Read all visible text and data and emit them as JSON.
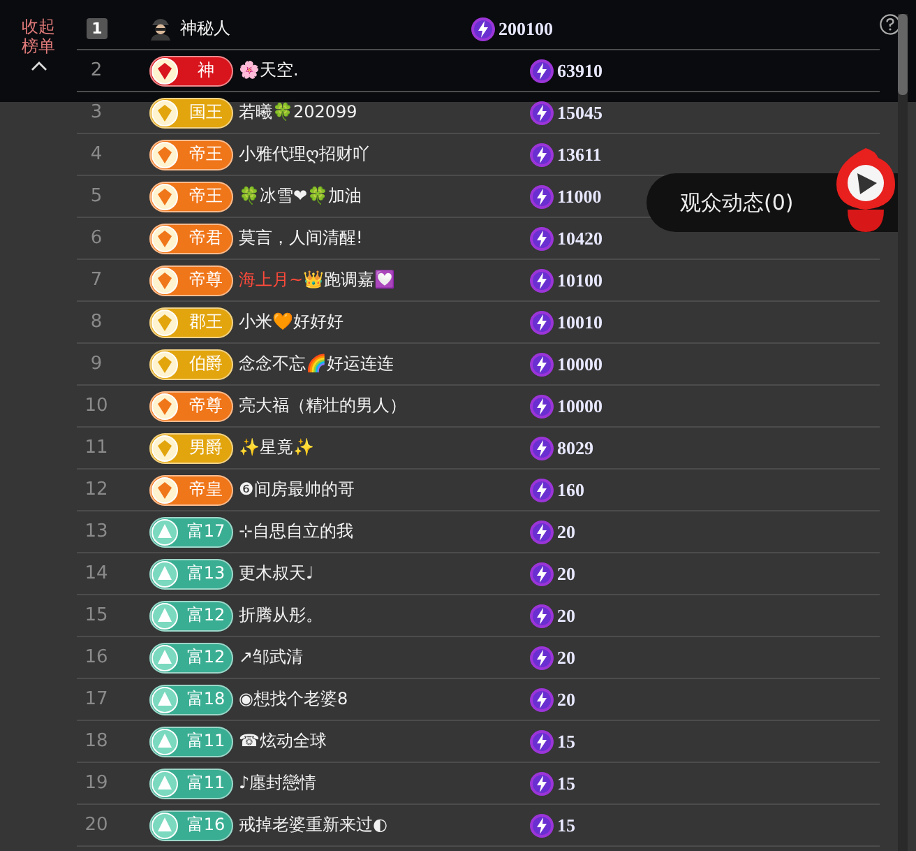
{
  "toggle": {
    "label": "收起榜单"
  },
  "rows": [
    {
      "rank": "1",
      "kind": "avatar",
      "name": "神秘人",
      "score": "200100"
    },
    {
      "rank": "2",
      "kind": "badge",
      "badge": {
        "kind": "noble",
        "label": "神",
        "color": "#d8141c"
      },
      "name": "🌸天空.",
      "score": "63910"
    },
    {
      "rank": "3",
      "kind": "badge",
      "badge": {
        "kind": "noble",
        "label": "国王",
        "color": "#e2a50e"
      },
      "name": "若曦🍀202099",
      "score": "15045"
    },
    {
      "rank": "4",
      "kind": "badge",
      "badge": {
        "kind": "noble",
        "label": "帝王",
        "color": "#f0761a"
      },
      "name": "小雅代理ღ招财吖",
      "score": "13611"
    },
    {
      "rank": "5",
      "kind": "badge",
      "badge": {
        "kind": "noble",
        "label": "帝王",
        "color": "#f0761a"
      },
      "name": "🍀冰雪❤🍀加油",
      "score": "11000"
    },
    {
      "rank": "6",
      "kind": "badge",
      "badge": {
        "kind": "noble",
        "label": "帝君",
        "color": "#f0761a"
      },
      "name": "莫言，人间清醒!",
      "score": "10420"
    },
    {
      "rank": "7",
      "kind": "badge",
      "badge": {
        "kind": "noble",
        "label": "帝尊",
        "color": "#f0761a"
      },
      "name_prefix": "海上月~",
      "name": "👑跑调嘉💟",
      "score": "10100"
    },
    {
      "rank": "8",
      "kind": "badge",
      "badge": {
        "kind": "noble",
        "label": "郡王",
        "color": "#e2a50e"
      },
      "name": "小米🧡好好好",
      "score": "10010"
    },
    {
      "rank": "9",
      "kind": "badge",
      "badge": {
        "kind": "noble",
        "label": "伯爵",
        "color": "#e2a50e"
      },
      "name": "念念不忘🌈好运连连",
      "score": "10000"
    },
    {
      "rank": "10",
      "kind": "badge",
      "badge": {
        "kind": "noble",
        "label": "帝尊",
        "color": "#f0761a"
      },
      "name": "亮大福（精壮的男人）",
      "score": "10000"
    },
    {
      "rank": "11",
      "kind": "badge",
      "badge": {
        "kind": "noble",
        "label": "男爵",
        "color": "#e2a50e"
      },
      "name": "✨星竟✨",
      "score": "8029"
    },
    {
      "rank": "12",
      "kind": "badge",
      "badge": {
        "kind": "noble",
        "label": "帝皇",
        "color": "#f0761a"
      },
      "name": "❻间房最帅的哥",
      "score": "160"
    },
    {
      "rank": "13",
      "kind": "badge",
      "badge": {
        "kind": "rich",
        "label": "富17",
        "color": "#3aae93"
      },
      "name": "⊹自思自立的我",
      "score": "20"
    },
    {
      "rank": "14",
      "kind": "badge",
      "badge": {
        "kind": "rich",
        "label": "富13",
        "color": "#3aae93"
      },
      "name": "更木叔天♩",
      "score": "20"
    },
    {
      "rank": "15",
      "kind": "badge",
      "badge": {
        "kind": "rich",
        "label": "富12",
        "color": "#3aae93"
      },
      "name": "折腾从彤。",
      "score": "20"
    },
    {
      "rank": "16",
      "kind": "badge",
      "badge": {
        "kind": "rich",
        "label": "富12",
        "color": "#3aae93"
      },
      "name": "↗邹武清",
      "score": "20"
    },
    {
      "rank": "17",
      "kind": "badge",
      "badge": {
        "kind": "rich",
        "label": "富18",
        "color": "#3aae93"
      },
      "name": "◉想找个老婆8",
      "score": "20"
    },
    {
      "rank": "18",
      "kind": "badge",
      "badge": {
        "kind": "rich",
        "label": "富11",
        "color": "#3aae93"
      },
      "name": "☎炫动全球",
      "score": "15"
    },
    {
      "rank": "19",
      "kind": "badge",
      "badge": {
        "kind": "rich",
        "label": "富11",
        "color": "#3aae93"
      },
      "name": "♪廛封戀情",
      "score": "15"
    },
    {
      "rank": "20",
      "kind": "badge",
      "badge": {
        "kind": "rich",
        "label": "富16",
        "color": "#3aae93"
      },
      "name": "戒掉老婆重新来过◐",
      "score": "15"
    }
  ],
  "audience_button": {
    "label": "观众动态(0)"
  }
}
